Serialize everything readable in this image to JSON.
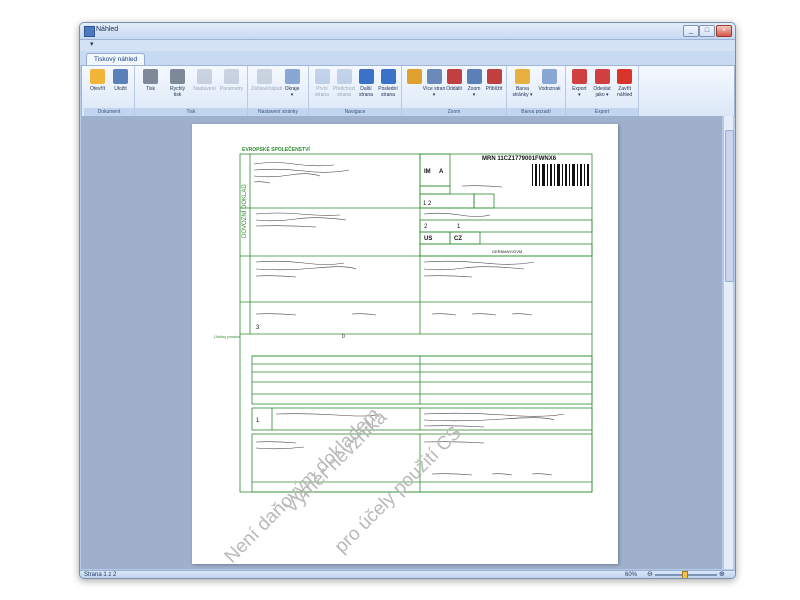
{
  "window": {
    "title": "Náhled",
    "icon": "preview-app-icon"
  },
  "qat": {
    "item": "▾"
  },
  "tabs": [
    {
      "label": "Tiskový náhled"
    }
  ],
  "ribbon": {
    "groups": [
      {
        "label": "Dokument",
        "buttons": [
          {
            "label": "Otevřít",
            "icon": "open-folder-icon",
            "disabled": false
          },
          {
            "label": "Uložit",
            "icon": "save-icon",
            "disabled": false
          }
        ]
      },
      {
        "label": "Tisk",
        "buttons": [
          {
            "label": "Tisk",
            "icon": "print-icon",
            "disabled": false
          },
          {
            "label": "Rychlý\ntisk",
            "icon": "quick-print-icon",
            "disabled": false
          },
          {
            "label": "Nastavení",
            "icon": "print-settings-icon",
            "disabled": true
          },
          {
            "label": "Parametry",
            "icon": "parameters-icon",
            "disabled": true
          }
        ]
      },
      {
        "label": "Nastavení stránky",
        "buttons": [
          {
            "label": "Záhlaví/zápatí",
            "icon": "header-footer-icon",
            "disabled": true
          },
          {
            "label": "Okraje\n▾",
            "icon": "margins-icon",
            "disabled": false
          }
        ]
      },
      {
        "label": "Navigace",
        "buttons": [
          {
            "label": "První\nstrana",
            "icon": "first-page-icon",
            "disabled": true
          },
          {
            "label": "Předchozí\nstrana",
            "icon": "previous-page-icon",
            "disabled": true
          },
          {
            "label": "Další\nstrana",
            "icon": "next-page-icon",
            "disabled": false
          },
          {
            "label": "Poslední\nstrana",
            "icon": "last-page-icon",
            "disabled": false
          }
        ]
      },
      {
        "label": "Zoom",
        "buttons": [
          {
            "label": "",
            "icon": "pointer-hand-icon",
            "disabled": false
          },
          {
            "label": "Více stran\n▾",
            "icon": "multiple-pages-icon",
            "disabled": false
          },
          {
            "label": "Oddálit",
            "icon": "zoom-out-icon",
            "disabled": false
          },
          {
            "label": "Zoom\n▾",
            "icon": "zoom-icon",
            "disabled": false
          },
          {
            "label": "Přiblížit",
            "icon": "zoom-in-icon",
            "disabled": false
          }
        ]
      },
      {
        "label": "Barva pozadí",
        "buttons": [
          {
            "label": "Barva\nstránky ▾",
            "icon": "page-color-icon",
            "disabled": false
          },
          {
            "label": "Vodoznak",
            "icon": "watermark-icon",
            "disabled": false
          }
        ]
      },
      {
        "label": "Export",
        "buttons": [
          {
            "label": "Export\n▾",
            "icon": "export-pdf-icon",
            "disabled": false
          },
          {
            "label": "Odeslat\njako ▾",
            "icon": "send-email-icon",
            "disabled": false
          },
          {
            "label": "Zavřít\nnáhled",
            "icon": "close-preview-icon",
            "disabled": false
          }
        ]
      }
    ]
  },
  "document": {
    "header_left": "EVROPSKÉ SPOLEČENSTVÍ",
    "mrn": "MRN  11CZ1779001FWNX6",
    "im": "IM",
    "a": "A",
    "form_no": "1  2",
    "side_label": "DOVOZNÍ DOKLAD",
    "field_2": "2",
    "field_1": "1",
    "side_label2": "Úložný\nprostor",
    "us": "US",
    "cz": "CZ",
    "code_page": "0",
    "num_3": "3",
    "num_1": "1",
    "line_country": "GERMANY/DVM",
    "watermark_line1": "Není daňovým dokladem",
    "watermark_line2": "Výměr nevzniká",
    "watermark_line3": "pro účely použití CS"
  },
  "status": {
    "page": "Strana 1 z 2",
    "zoom": "60%"
  },
  "colors": {
    "form_green": "#2e8b2e",
    "watermark": "#b9b9b9"
  }
}
